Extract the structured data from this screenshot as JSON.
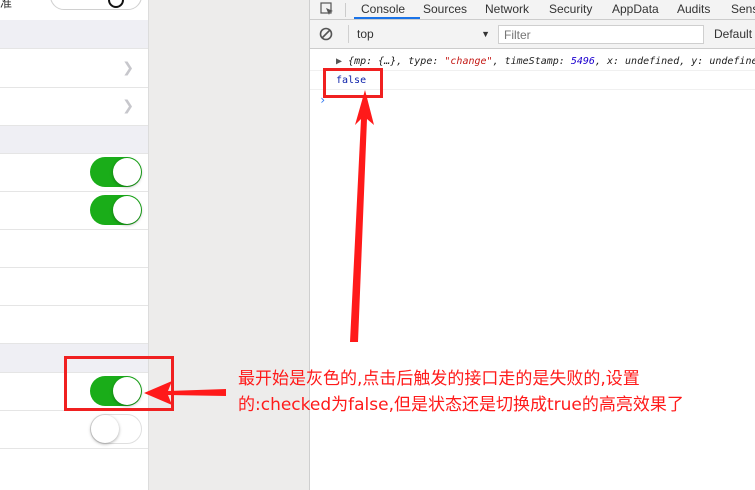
{
  "devtools": {
    "tabs": [
      "Console",
      "Sources",
      "Network",
      "Security",
      "AppData",
      "Audits",
      "Sensors"
    ],
    "active_tab": "Console",
    "context": "top",
    "filter_placeholder": "Filter",
    "levels_label": "Default",
    "log_entry": {
      "open": "{mp: {…}, type: ",
      "type_value": "\"change\"",
      "mid": ", timeStamp: ",
      "timestamp_value": "5496",
      "tail": ", x: undefined, y: undefined"
    },
    "output_value": "false",
    "prompt_symbol": "›",
    "accent": "#1a73e8"
  },
  "phone": {
    "top_text": "准",
    "switches": [
      {
        "name": "switch-1",
        "on": true
      },
      {
        "name": "switch-2",
        "on": true
      },
      {
        "name": "switch-3",
        "on": true
      },
      {
        "name": "switch-4",
        "on": false
      }
    ],
    "switch_on_color": "#1aad19"
  },
  "annotation": {
    "text": "最开始是灰色的,点击后触发的接口走的是失败的,设置的:checked为false,但是状态还是切换成true的高亮效果了",
    "color": "#ff1a1a"
  }
}
